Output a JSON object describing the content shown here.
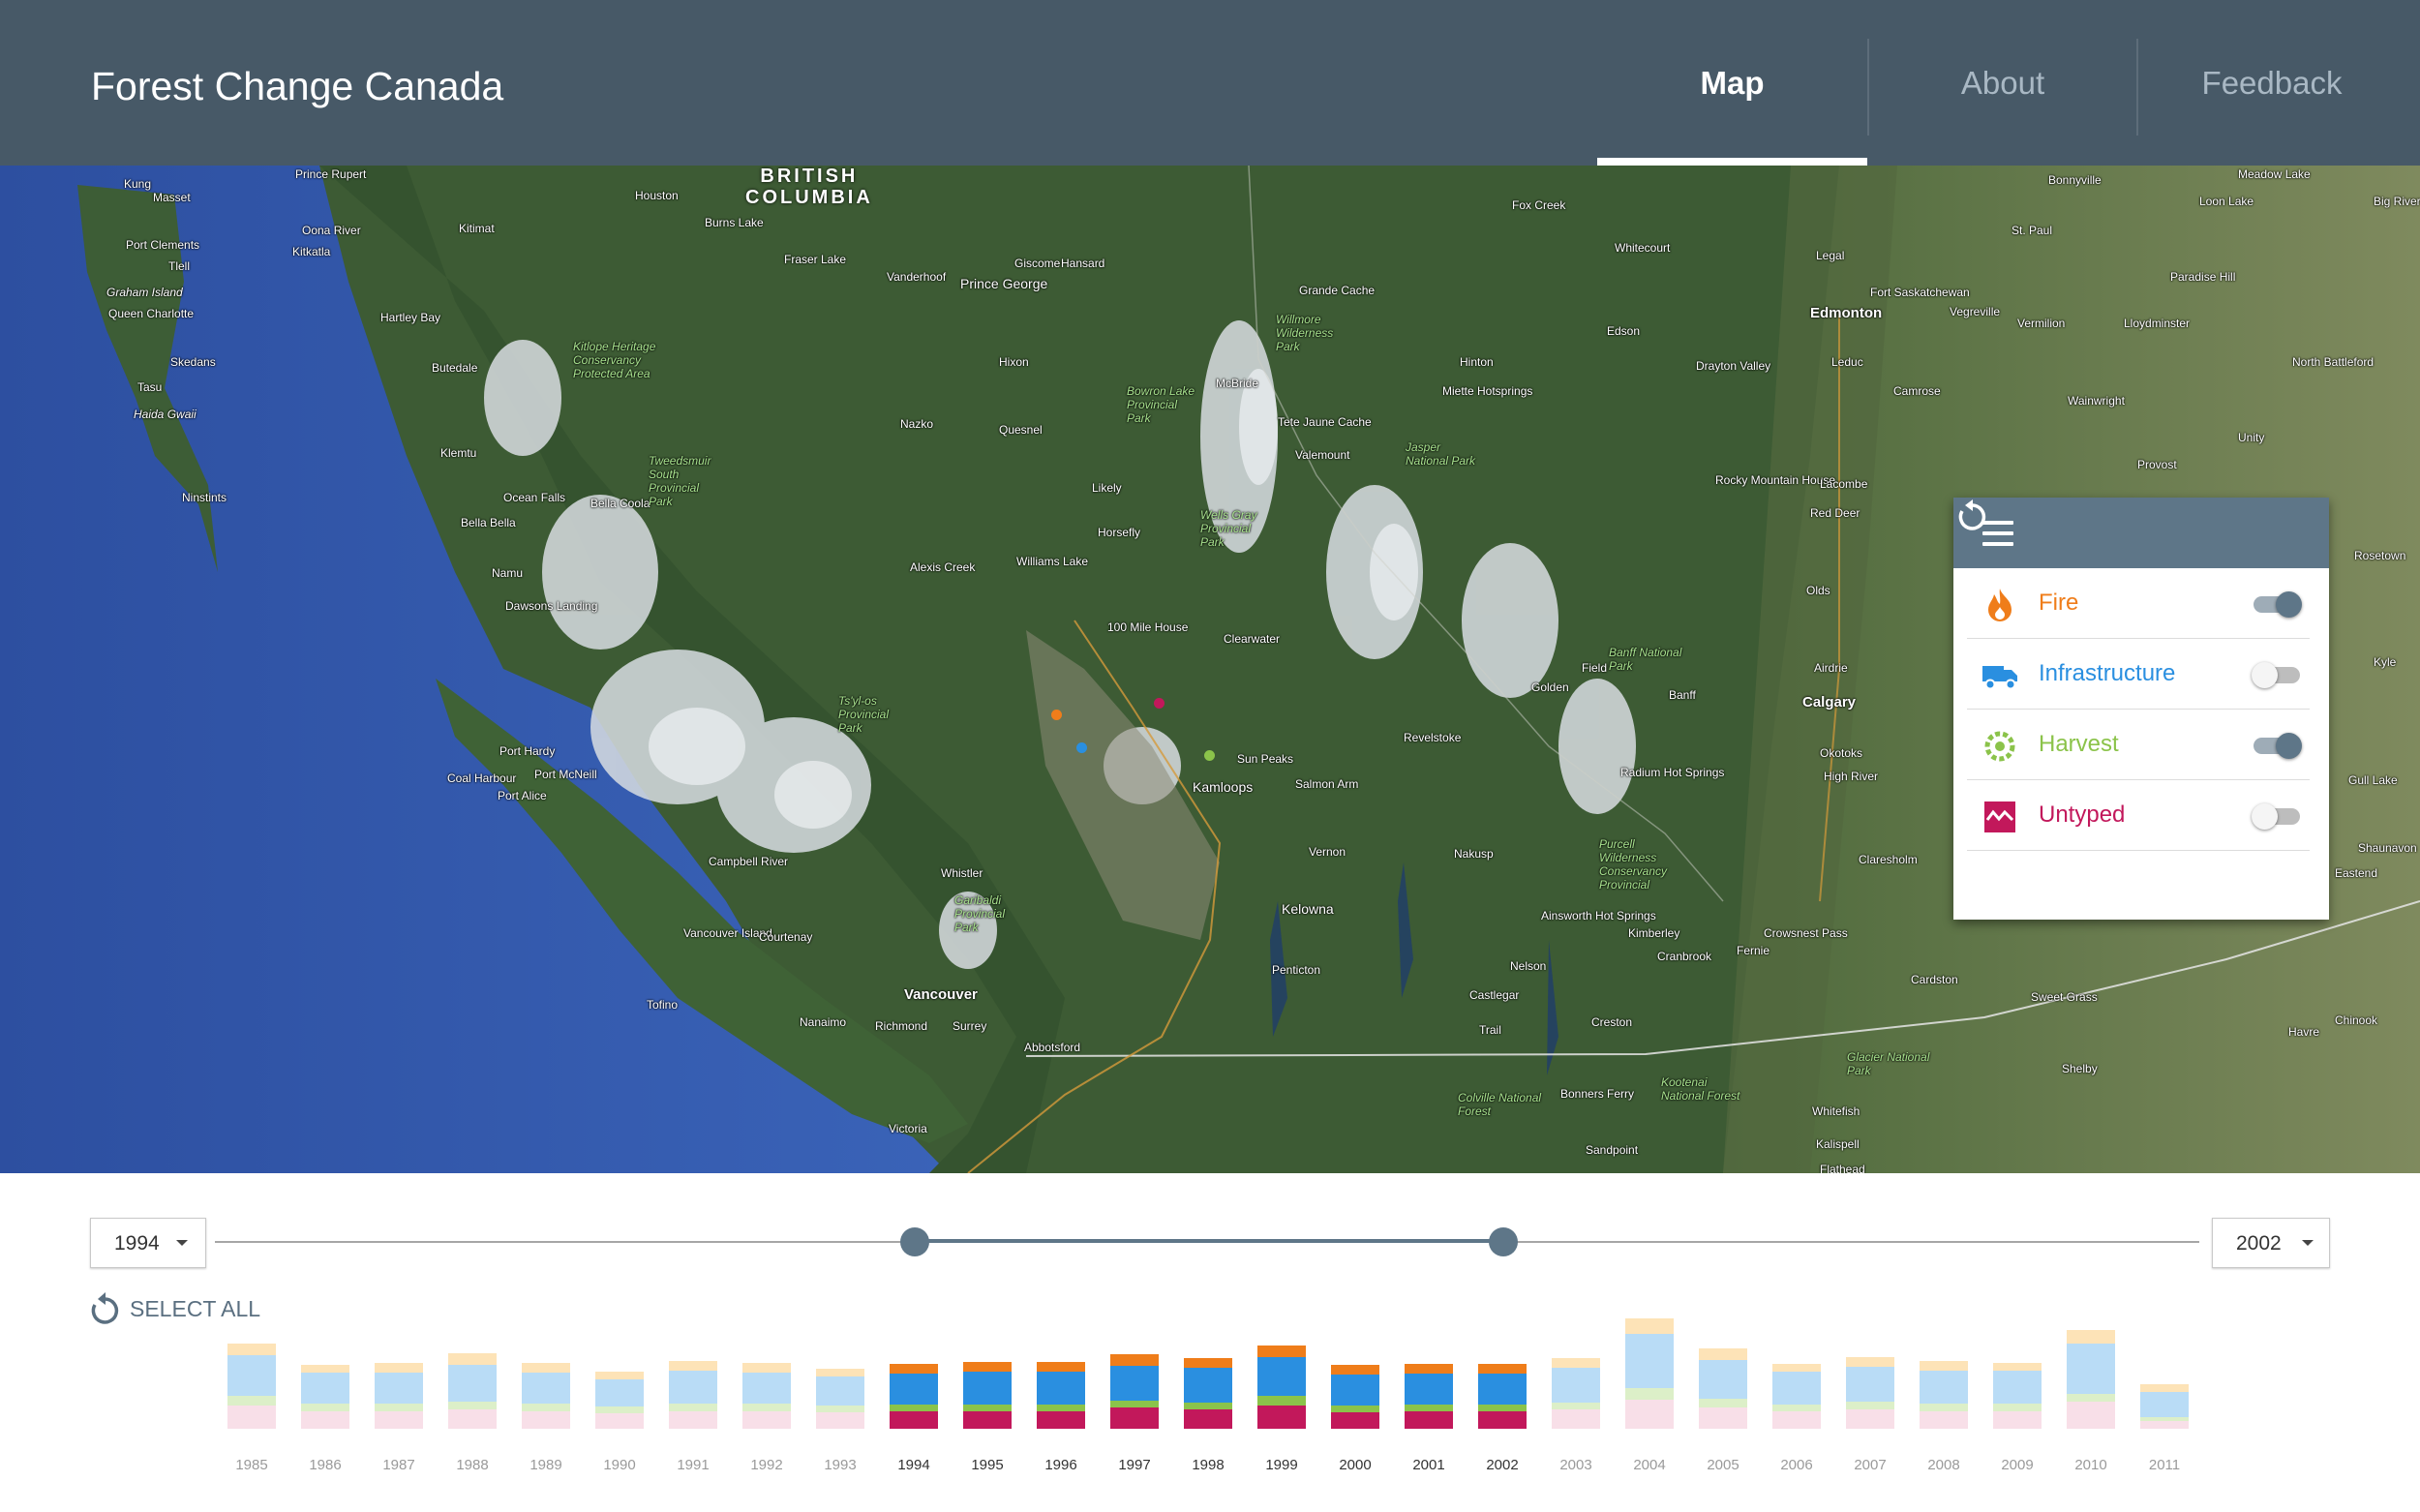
{
  "header": {
    "title": "Forest Change Canada",
    "nav": [
      {
        "label": "Map",
        "active": true
      },
      {
        "label": "About",
        "active": false
      },
      {
        "label": "Feedback",
        "active": false
      }
    ]
  },
  "map": {
    "region": "BRITISH COLUMBIA",
    "places": [
      "Prince Rupert",
      "Kung",
      "Masset",
      "Port Clements",
      "Tlell",
      "Graham Island",
      "Queen Charlotte",
      "Skedans",
      "Tasu",
      "Haida Gwaii",
      "Ninstints",
      "Kitkatla",
      "Oona River",
      "Hartley Bay",
      "Butedale",
      "Kitimat",
      "Klemtu",
      "Ocean Falls",
      "Bella Bella",
      "Bella Coola",
      "Namu",
      "Dawsons Landing",
      "Port Hardy",
      "Coal Harbour",
      "Port McNeill",
      "Port Alice",
      "Campbell River",
      "Tofino",
      "Vancouver Island",
      "Courtenay",
      "Nanaimo",
      "Richmond",
      "Surrey",
      "Vancouver",
      "Abbotsford",
      "Victoria",
      "Whistler",
      "Houston",
      "Burns Lake",
      "Fraser Lake",
      "Vanderhoof",
      "Giscome",
      "Hansard",
      "Prince George",
      "Hixon",
      "Nazko",
      "Quesnel",
      "Likely",
      "Horsefly",
      "Williams Lake",
      "Alexis Creek",
      "100 Mile House",
      "Clearwater",
      "Sun Peaks",
      "Kamloops",
      "Salmon Arm",
      "Vernon",
      "Kelowna",
      "Penticton",
      "Nelson",
      "Castlegar",
      "Trail",
      "Creston",
      "Nakusp",
      "Revelstoke",
      "Golden",
      "Field",
      "Banff",
      "Calgary",
      "Radium Hot Springs",
      "Kimberley",
      "Cranbrook",
      "Fernie",
      "Ainsworth Hot Springs",
      "Crowsnest Pass",
      "Bonners Ferry",
      "Sandpoint",
      "Grande Cache",
      "McBride",
      "Tete Jaune Cache",
      "Valemount",
      "Hinton",
      "Miette Hotsprings",
      "Edson",
      "Drayton Valley",
      "Rocky Mountain House",
      "Red Deer",
      "Olds",
      "Airdrie",
      "Okotoks",
      "High River",
      "Claresholm",
      "Cardston",
      "Edmonton",
      "Fort Saskatchewan",
      "Leduc",
      "Legal",
      "Camrose",
      "Lacombe",
      "Wainwright",
      "Vegreville",
      "Vermilion",
      "Lloydminster",
      "Provost",
      "St. Paul",
      "Bonnyville",
      "Whitecourt",
      "Fox Creek",
      "Paradise Hill",
      "Loon Lake",
      "Meadow Lake",
      "Big River",
      "North Battleford",
      "Unity",
      "Rosetown",
      "Kyle",
      "Gull Lake",
      "Shaunavon",
      "Eastend",
      "Sweet Grass",
      "Chinook",
      "Havre",
      "Shelby",
      "Whitefish",
      "Kalispell",
      "Flathead"
    ],
    "parks": [
      "Kitlope Heritage Conservancy Protected Area",
      "Tweedsmuir South Provincial Park",
      "Bowron Lake Provincial Park",
      "Willmore Wilderness Park",
      "Jasper National Park",
      "Wells Gray Provincial Park",
      "Ts'yl-os Provincial Park",
      "Garibaldi Provincial Park",
      "Banff National Park",
      "Purcell Wilderness Conservancy Provincial",
      "Kootenai National Forest",
      "Colville National Forest",
      "Glacier National Park"
    ]
  },
  "legend": {
    "items": [
      {
        "label": "Fire",
        "color": "#ef7d1a",
        "icon": "fire-icon",
        "on": true
      },
      {
        "label": "Infrastructure",
        "color": "#2a8fe0",
        "icon": "truck-icon",
        "on": false
      },
      {
        "label": "Harvest",
        "color": "#8bc34a",
        "icon": "saw-blade-icon",
        "on": true
      },
      {
        "label": "Untyped",
        "color": "#c2185b",
        "icon": "wave-icon",
        "on": false
      }
    ]
  },
  "timeline": {
    "start_year": "1994",
    "end_year": "2002",
    "select_all_label": "SELECT ALL"
  },
  "chart_data": {
    "type": "bar",
    "stacked": true,
    "categories": [
      "1985",
      "1986",
      "1987",
      "1988",
      "1989",
      "1990",
      "1991",
      "1992",
      "1993",
      "1994",
      "1995",
      "1996",
      "1997",
      "1998",
      "1999",
      "2000",
      "2001",
      "2002",
      "2003",
      "2004",
      "2005",
      "2006",
      "2007",
      "2008",
      "2009",
      "2010",
      "2011"
    ],
    "selected_range": [
      "1994",
      "2002"
    ],
    "series": [
      {
        "color": "#c2185b",
        "values": [
          24,
          18,
          18,
          20,
          18,
          16,
          18,
          18,
          17,
          18,
          18,
          18,
          22,
          20,
          24,
          17,
          18,
          18,
          20,
          30,
          22,
          18,
          20,
          18,
          18,
          28,
          8
        ]
      },
      {
        "color": "#8bc34a",
        "values": [
          10,
          8,
          8,
          8,
          8,
          7,
          8,
          8,
          7,
          7,
          7,
          7,
          7,
          7,
          10,
          7,
          7,
          7,
          7,
          12,
          9,
          7,
          8,
          8,
          8,
          8,
          4
        ]
      },
      {
        "color": "#2a8fe0",
        "values": [
          42,
          32,
          32,
          38,
          32,
          28,
          34,
          32,
          30,
          32,
          34,
          34,
          36,
          36,
          40,
          32,
          32,
          32,
          36,
          56,
          40,
          34,
          36,
          34,
          34,
          52,
          26
        ]
      },
      {
        "color": "#ef7d1a",
        "values": [
          12,
          8,
          10,
          12,
          10,
          8,
          10,
          10,
          8,
          10,
          10,
          10,
          12,
          10,
          12,
          10,
          10,
          10,
          10,
          16,
          12,
          8,
          10,
          10,
          8,
          14,
          8
        ]
      }
    ],
    "ylim": [
      0,
      130
    ]
  }
}
